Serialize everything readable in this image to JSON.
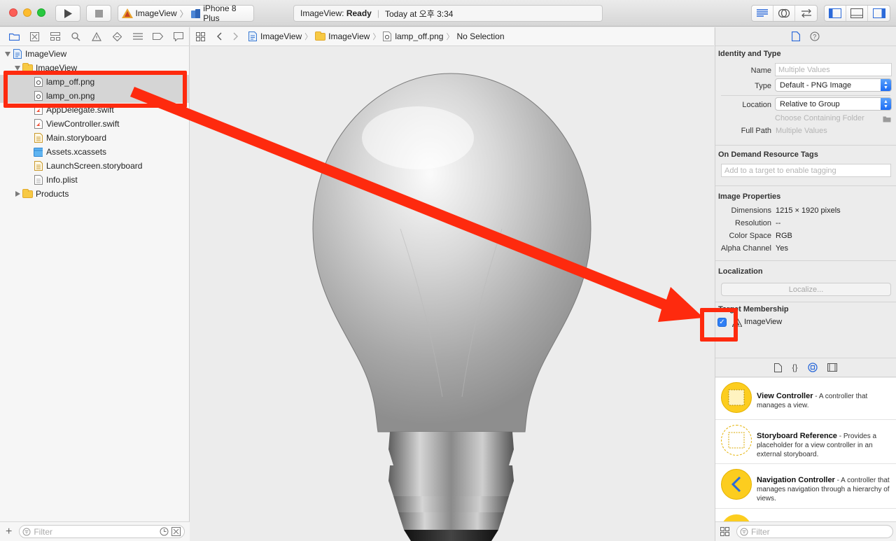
{
  "toolbar": {
    "scheme_name": "ImageView",
    "device_name": "iPhone 8 Plus",
    "activity_project": "ImageView:",
    "activity_status": "Ready",
    "activity_time": "Today at 오후 3:34"
  },
  "navigator": {
    "tree": [
      {
        "label": "ImageView",
        "kind": "project",
        "depth": 0
      },
      {
        "label": "ImageView",
        "kind": "folder",
        "depth": 1
      },
      {
        "label": "lamp_off.png",
        "kind": "image",
        "depth": 2
      },
      {
        "label": "lamp_on.png",
        "kind": "image",
        "depth": 2
      },
      {
        "label": "AppDelegate.swift",
        "kind": "swift",
        "depth": 2
      },
      {
        "label": "ViewController.swift",
        "kind": "swift",
        "depth": 2
      },
      {
        "label": "Main.storyboard",
        "kind": "storyboard",
        "depth": 2
      },
      {
        "label": "Assets.xcassets",
        "kind": "assets",
        "depth": 2
      },
      {
        "label": "LaunchScreen.storyboard",
        "kind": "storyboard",
        "depth": 2
      },
      {
        "label": "Info.plist",
        "kind": "plist",
        "depth": 2
      },
      {
        "label": "Products",
        "kind": "folder",
        "depth": 1
      }
    ],
    "filter_placeholder": "Filter"
  },
  "jumpbar": {
    "crumbs": [
      "ImageView",
      "ImageView",
      "lamp_off.png",
      "No Selection"
    ]
  },
  "inspector": {
    "identity": {
      "title": "Identity and Type",
      "name_label": "Name",
      "name_value": "Multiple Values",
      "type_label": "Type",
      "type_value": "Default - PNG Image",
      "location_label": "Location",
      "location_value": "Relative to Group",
      "choose_folder": "Choose Containing Folder",
      "full_path_label": "Full Path",
      "full_path_value": "Multiple Values"
    },
    "odr": {
      "title": "On Demand Resource Tags",
      "placeholder": "Add to a target to enable tagging"
    },
    "image_props": {
      "title": "Image Properties",
      "rows": [
        {
          "label": "Dimensions",
          "value": "1215 × 1920 pixels"
        },
        {
          "label": "Resolution",
          "value": "--"
        },
        {
          "label": "Color Space",
          "value": "RGB"
        },
        {
          "label": "Alpha Channel",
          "value": "Yes"
        }
      ]
    },
    "localization": {
      "title": "Localization",
      "button": "Localize..."
    },
    "target": {
      "title": "Target Membership",
      "target_name": "ImageView",
      "checked": true
    },
    "library": [
      {
        "name": "View Controller",
        "desc": " - A controller that manages a view."
      },
      {
        "name": "Storyboard Reference",
        "desc": " - Provides a placeholder for a view controller in an external storyboard."
      },
      {
        "name": "Navigation Controller",
        "desc": " - A controller that manages navigation through a hierarchy of views."
      }
    ],
    "filter_placeholder": "Filter"
  },
  "colors": {
    "annotation": "#fe2a0e",
    "accent": "#2f7ff5",
    "folder": "#f7c944"
  }
}
